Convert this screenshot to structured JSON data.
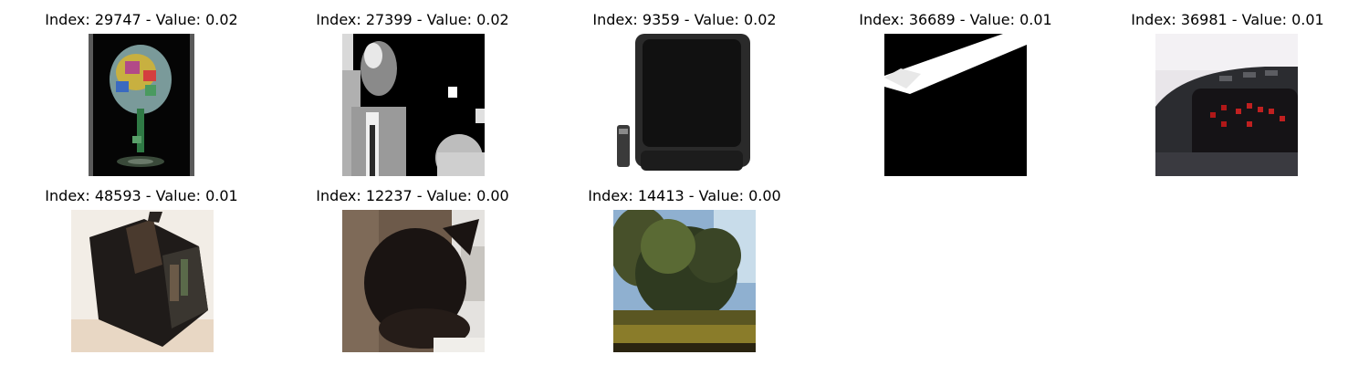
{
  "items": [
    {
      "index": "29747",
      "value": "0.02",
      "title": "Index: 29747 - Value: 0.02",
      "subject": "colorful-goblet-on-black"
    },
    {
      "index": "27399",
      "value": "0.02",
      "title": "Index: 27399 - Value: 0.02",
      "subject": "grayscale-man-portrait"
    },
    {
      "index": "9359",
      "value": "0.02",
      "title": "Index: 9359 - Value: 0.02",
      "subject": "crt-television-with-remote"
    },
    {
      "index": "36689",
      "value": "0.01",
      "title": "Index: 36689 - Value: 0.01",
      "subject": "white-streak-on-black"
    },
    {
      "index": "36981",
      "value": "0.01",
      "title": "Index: 36981 - Value: 0.01",
      "subject": "alarm-clock-red-digits"
    },
    {
      "index": "48593",
      "value": "0.01",
      "title": "Index: 48593 - Value: 0.01",
      "subject": "dark-box-object"
    },
    {
      "index": "12237",
      "value": "0.00",
      "title": "Index: 12237 - Value: 0.00",
      "subject": "black-cat-on-tree"
    },
    {
      "index": "14413",
      "value": "0.00",
      "title": "Index: 14413 - Value: 0.00",
      "subject": "tree-landscape"
    }
  ]
}
